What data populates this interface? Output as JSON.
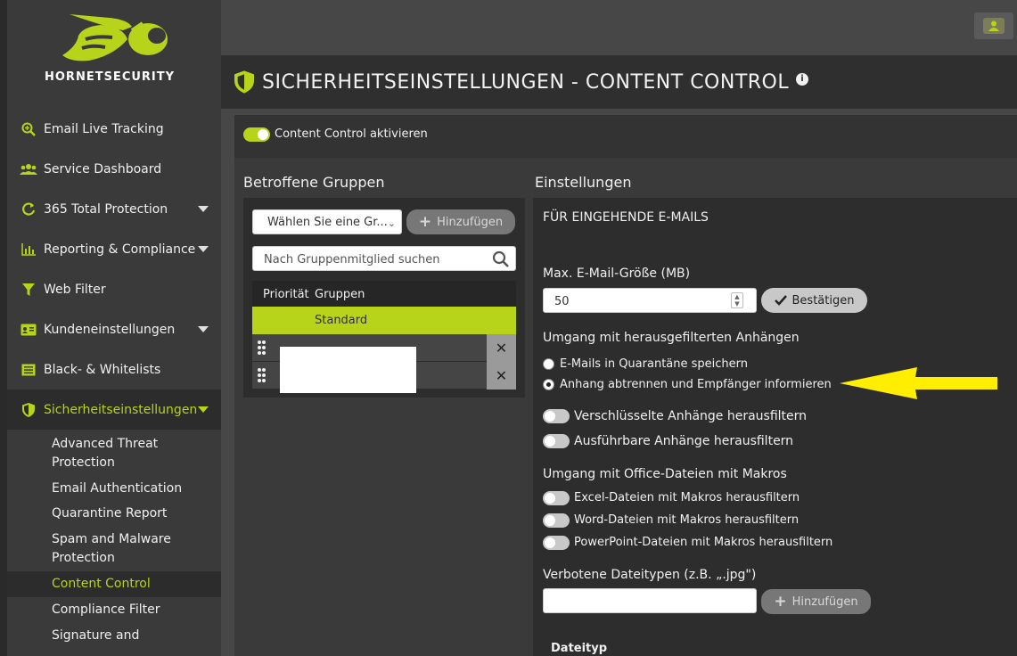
{
  "brand": {
    "name": "HORNETSECURITY",
    "accent": "#b7d31a"
  },
  "sidebar": {
    "items": [
      {
        "label": "Email Live Tracking",
        "icon": "search-plus-icon",
        "caret": false
      },
      {
        "label": "Service Dashboard",
        "icon": "users-icon",
        "caret": false
      },
      {
        "label": "365 Total Protection",
        "icon": "refresh-icon",
        "caret": true
      },
      {
        "label": "Reporting & Compliance",
        "icon": "bar-chart-icon",
        "caret": true
      },
      {
        "label": "Web Filter",
        "icon": "filter-icon",
        "caret": false
      },
      {
        "label": "Kundeneinstellungen",
        "icon": "id-card-icon",
        "caret": true
      },
      {
        "label": "Black- & Whitelists",
        "icon": "list-icon",
        "caret": false
      },
      {
        "label": "Sicherheitseinstellungen",
        "icon": "shield-icon",
        "caret": true,
        "active": true
      }
    ],
    "subitems": [
      "Advanced Threat Protection",
      "Email Authentication",
      "Quarantine Report",
      "Spam and Malware Protection",
      "Content Control",
      "Compliance Filter",
      "Signature and"
    ],
    "current_sub": "Content Control"
  },
  "header": {
    "title": "SICHERHEITSEINSTELLUNGEN - CONTENT CONTROL",
    "info_icon": "info-icon"
  },
  "content_control": {
    "toggle_label": "Content Control aktivieren",
    "enabled": true
  },
  "groups": {
    "heading": "Betroffene Gruppen",
    "select_value": "Wählen Sie eine Gr...",
    "add_label": "Hinzufügen",
    "search_placeholder": "Nach Gruppenmitglied suchen",
    "col_priority": "Priorität",
    "col_groups": "Gruppen",
    "rows": [
      "Standard"
    ]
  },
  "settings": {
    "heading": "Einstellungen",
    "section_incoming": "FÜR EINGEHENDE E-MAILS",
    "max_size_label": "Max. E-Mail-Größe (MB)",
    "max_size_value": "50",
    "confirm_label": "Bestätigen",
    "attachments_label": "Umgang mit herausgefilterten Anhängen",
    "radio_quarantine": "E-Mails in Quarantäne speichern",
    "radio_detach": "Anhang abtrennen und Empfänger informieren",
    "radio_selected": "detach",
    "toggle_encrypted": "Verschlüsselte Anhänge herausfiltern",
    "toggle_executable": "Ausführbare Anhänge herausfiltern",
    "office_label": "Umgang mit Office-Dateien mit Makros",
    "toggle_excel": "Excel-Dateien mit Makros herausfiltern",
    "toggle_word": "Word-Dateien mit Makros herausfiltern",
    "toggle_ppt": "PowerPoint-Dateien mit Makros herausfiltern",
    "forbidden_label": "Verbotene Dateitypen (z.B. „.jpg\")",
    "forbidden_add": "Hinzufügen",
    "filetype_col": "Dateityp"
  },
  "annotation": {
    "arrow_color": "#ffee00"
  }
}
